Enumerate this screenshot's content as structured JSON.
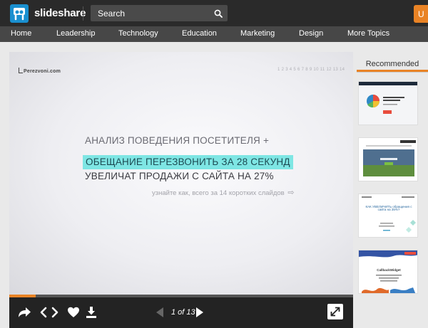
{
  "header": {
    "brand": "slideshare",
    "search_placeholder": "Search",
    "upload_label": "U"
  },
  "nav": {
    "items": [
      "Home",
      "Leadership",
      "Technology",
      "Education",
      "Marketing",
      "Design",
      "More Topics"
    ]
  },
  "slide": {
    "logo_text": "Perezvoni.com",
    "page_dots": "1 2 3 4 5 6 7 8 9 10 11 12 13 14",
    "line1": "АНАЛИЗ ПОВЕДЕНИЯ ПОСЕТИТЕЛЯ +",
    "line2": "ОБЕЩАНИЕ ПЕРЕЗВОНИТЬ ЗА 28 СЕКУНД",
    "line3": "УВЕЛИЧАТ ПРОДАЖИ С САЙТА НА 27%",
    "subline": "узнайте как, всего за 14 коротких слайдов"
  },
  "player": {
    "page_indicator": "1 of 13",
    "progress_fraction": 0.077
  },
  "recommended": {
    "title": "Recommended",
    "thumb3_text": "КАК УВЕЛИЧИТЬ обращения с сайта на 35%?",
    "thumb4_text": "CallbackWidget"
  },
  "colors": {
    "accent": "#e98325",
    "brand_blue": "#1a90d0",
    "highlight": "#7ee6e4"
  }
}
